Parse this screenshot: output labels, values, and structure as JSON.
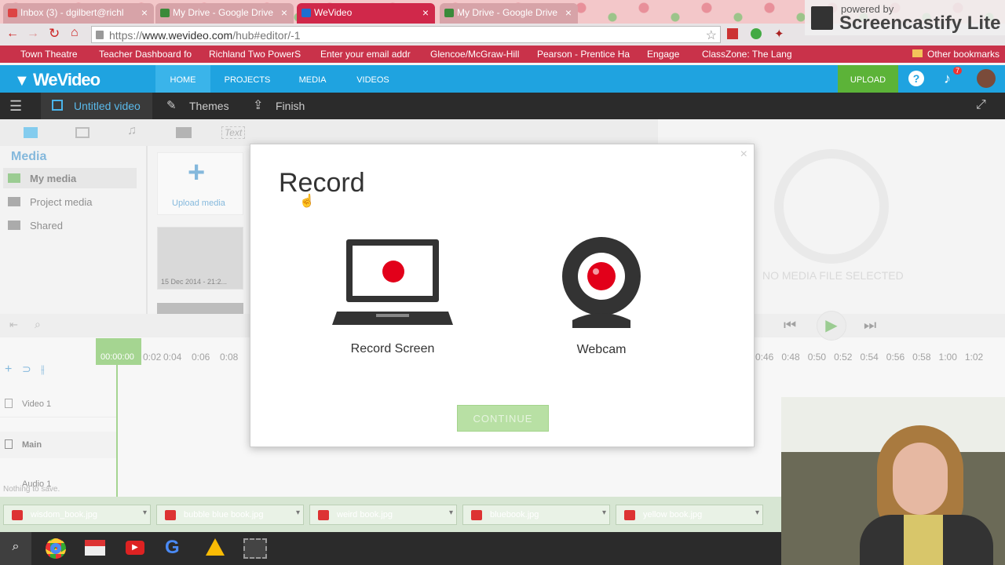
{
  "browser": {
    "tabs": [
      {
        "label": "Inbox (3) - dgilbert@richl",
        "icon": "gmail-icon",
        "color": "#d44"
      },
      {
        "label": "My Drive - Google Drive",
        "icon": "drive-icon",
        "color": "#3a8a3a"
      },
      {
        "label": "WeVideo",
        "icon": "wevideo-icon",
        "color": "#1f6fd0"
      },
      {
        "label": "My Drive - Google Drive",
        "icon": "drive-icon",
        "color": "#3a8a3a"
      }
    ],
    "url_prefix": "https://",
    "url_host": "www.wevideo.com",
    "url_path": "/hub#editor/-1",
    "bookmarks": [
      "Town Theatre",
      "Teacher Dashboard fo",
      "Richland Two PowerS",
      "Enter your email addr",
      "Glencoe/McGraw-Hill",
      "Pearson - Prentice Ha",
      "Engage",
      "ClassZone: The Lang"
    ],
    "other_bookmarks": "Other bookmarks"
  },
  "screencastify": {
    "line1": "powered by",
    "line2": "Screencastify Lite"
  },
  "wevideo": {
    "logo": "WeVideo",
    "nav": [
      "HOME",
      "PROJECTS",
      "MEDIA",
      "VIDEOS"
    ],
    "upload": "UPLOAD",
    "notifications": "7",
    "toolbar": {
      "title": "Untitled video",
      "themes": "Themes",
      "finish": "Finish"
    },
    "media_tabs": {
      "text": "Text"
    },
    "media": {
      "heading": "Media",
      "items": [
        "My media",
        "Project media",
        "Shared"
      ],
      "upload_label": "Upload media",
      "thumb_caption": "15 Dec 2014 - 21:2..."
    },
    "preview": {
      "empty": "NO MEDIA FILE SELECTED"
    },
    "timeline": {
      "timecode": "00:00:00",
      "ticks": [
        "0:02",
        "0:04",
        "0:06",
        "0:08"
      ],
      "right_ticks": [
        "0:46",
        "0:48",
        "0:50",
        "0:52",
        "0:54",
        "0:56",
        "0:58",
        "1:00",
        "1:02"
      ],
      "tracks": [
        "Video 1",
        "Main",
        "Audio 1"
      ],
      "status": "Nothing to save."
    }
  },
  "modal": {
    "title": "Record",
    "options": [
      "Record Screen",
      "Webcam"
    ],
    "continue": "CONTINUE",
    "close": "×"
  },
  "downloads": [
    "wisdom_book.jpg",
    "bubble blue book.jpg",
    "weird book.jpg",
    "bluebook.jpg",
    "yellow book.jpg"
  ],
  "taskbar": [
    "search-icon",
    "chrome-icon",
    "gmail-icon",
    "youtube-icon",
    "google-icon",
    "drive-icon",
    "video-icon"
  ]
}
